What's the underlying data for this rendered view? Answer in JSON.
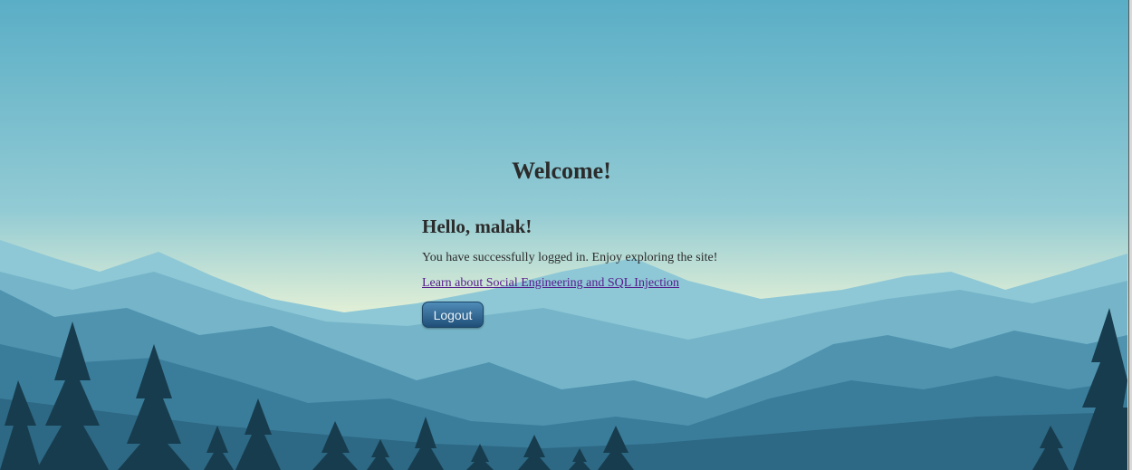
{
  "page": {
    "title": "Welcome!",
    "greeting": "Hello, malak!",
    "message": "You have successfully logged in. Enjoy exploring the site!",
    "learn_link": "Learn about Social Engineering and SQL Injection",
    "logout_label": "Logout"
  },
  "background": {
    "description_icon": "mountain-landscape-background",
    "sky_top": "#5fb0c7",
    "sky_glow": "#f1f6d8",
    "mountain_far": "#8fc7d5",
    "mountain_mid": "#4a8fac",
    "mountain_near": "#2f6f8c",
    "trees": "#163a4c"
  },
  "colors": {
    "text": "#2b2b2b",
    "link": "#551a8b",
    "button_top": "#4f8bb7",
    "button_bottom": "#1f4f78"
  }
}
